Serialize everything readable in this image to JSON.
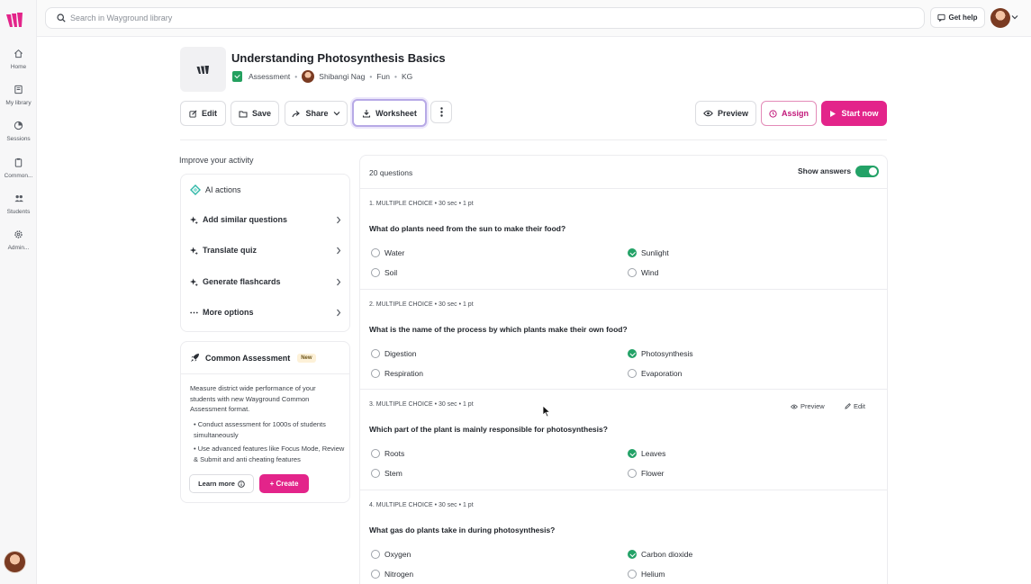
{
  "colors": {
    "brand": "#e3248a",
    "correct": "#23a267",
    "worksheet_outline": "#b7a9e6"
  },
  "sidebar": {
    "items": [
      {
        "label": "Home",
        "icon": "home-icon"
      },
      {
        "label": "My library",
        "icon": "library-icon"
      },
      {
        "label": "Sessions",
        "icon": "sessions-icon"
      },
      {
        "label": "Common...",
        "icon": "clipboard-icon"
      },
      {
        "label": "Students",
        "icon": "students-icon"
      },
      {
        "label": "Admin...",
        "icon": "gear-icon"
      }
    ]
  },
  "search": {
    "placeholder": "Search in Wayground library"
  },
  "topbar": {
    "help_label": "Get help"
  },
  "quiz": {
    "title": "Understanding Photosynthesis Basics",
    "type": "Assessment",
    "author": "Shibangi Nag",
    "tag": "Fun",
    "grade": "KG"
  },
  "toolbar": {
    "edit": "Edit",
    "save": "Save",
    "share": "Share",
    "worksheet": "Worksheet",
    "preview": "Preview",
    "assign": "Assign",
    "start": "Start now"
  },
  "improve": {
    "title": "Improve your activity",
    "ai_actions": "AI actions",
    "items": [
      "Add similar questions",
      "Translate quiz",
      "Generate flashcards",
      "More options"
    ]
  },
  "common_assessment": {
    "title": "Common Assessment",
    "badge": "New",
    "description": "Measure district wide performance of your students with new Wayground Common Assessment format.",
    "bullets": [
      "• Conduct assessment for 1000s of students simultaneously",
      "• Use advanced features like Focus Mode, Review & Submit and anti cheating features"
    ],
    "learn_more": "Learn more",
    "create": "+ Create"
  },
  "questions_panel": {
    "count": "20 questions",
    "show_answers": "Show answers",
    "show_answers_on": true,
    "hover_preview": "Preview",
    "hover_edit": "Edit"
  },
  "questions": [
    {
      "meta": "1. MULTIPLE CHOICE  •  30 sec  •  1 pt",
      "text": "What do plants need from the sun to make their food?",
      "options": [
        "Water",
        "Sunlight",
        "Soil",
        "Wind"
      ],
      "correct": 1
    },
    {
      "meta": "2. MULTIPLE CHOICE  •  30 sec  •  1 pt",
      "text": "What is the name of the process by which plants make their own food?",
      "options": [
        "Digestion",
        "Photosynthesis",
        "Respiration",
        "Evaporation"
      ],
      "correct": 1
    },
    {
      "meta": "3. MULTIPLE CHOICE  •  30 sec  •  1 pt",
      "text": "Which part of the plant is mainly responsible for photosynthesis?",
      "options": [
        "Roots",
        "Leaves",
        "Stem",
        "Flower"
      ],
      "correct": 1
    },
    {
      "meta": "4. MULTIPLE CHOICE  •  30 sec  •  1 pt",
      "text": "What gas do plants take in during photosynthesis?",
      "options": [
        "Oxygen",
        "Carbon dioxide",
        "Nitrogen",
        "Helium"
      ],
      "correct": 1
    }
  ]
}
